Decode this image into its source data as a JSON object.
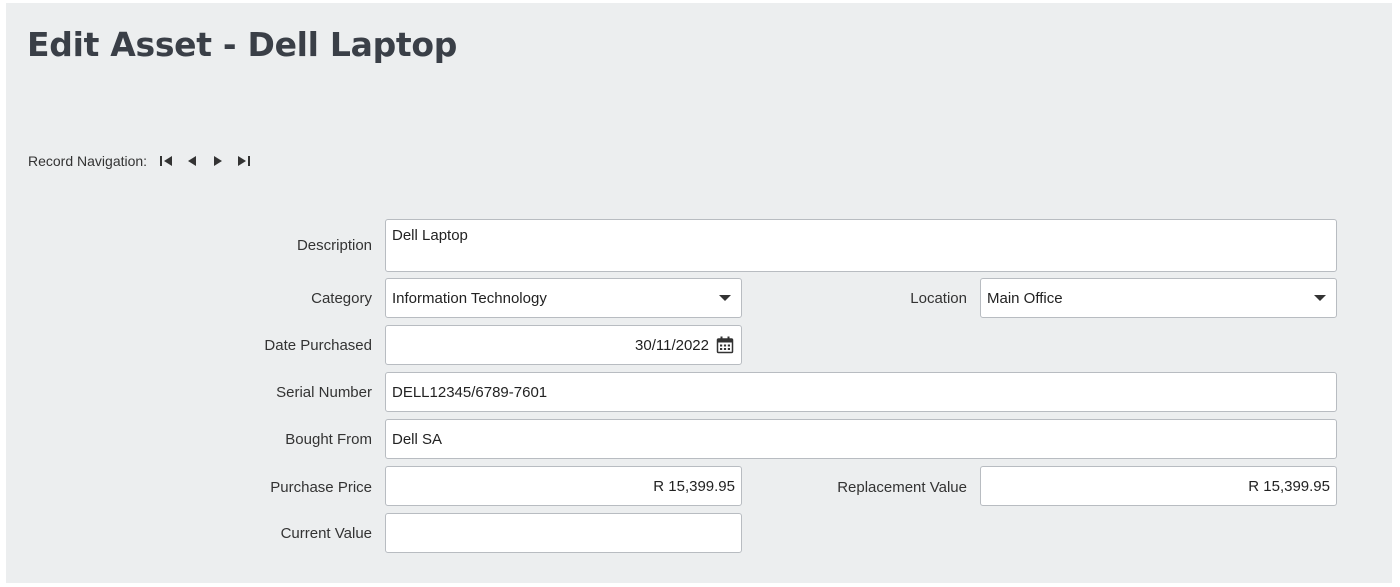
{
  "page": {
    "title": "Edit Asset - Dell Laptop"
  },
  "record_navigation": {
    "label": "Record Navigation:",
    "buttons": [
      "first-record-icon",
      "previous-record-icon",
      "next-record-icon",
      "last-record-icon"
    ]
  },
  "form": {
    "description": {
      "label": "Description",
      "value": "Dell Laptop"
    },
    "category": {
      "label": "Category",
      "value": "Information Technology"
    },
    "location": {
      "label": "Location",
      "value": "Main Office"
    },
    "date_purchased": {
      "label": "Date Purchased",
      "value": "30/11/2022",
      "icon": "calendar-icon"
    },
    "serial_number": {
      "label": "Serial Number",
      "value": "DELL12345/6789-7601"
    },
    "bought_from": {
      "label": "Bought From",
      "value": "Dell SA"
    },
    "purchase_price": {
      "label": "Purchase Price",
      "value": "R 15,399.95"
    },
    "replacement_value": {
      "label": "Replacement Value",
      "value": "R 15,399.95"
    },
    "current_value": {
      "label": "Current Value",
      "value": ""
    }
  },
  "colors": {
    "panel_background": "#eceeef",
    "title": "#3a3f47",
    "field_border": "#b8bcc1"
  }
}
